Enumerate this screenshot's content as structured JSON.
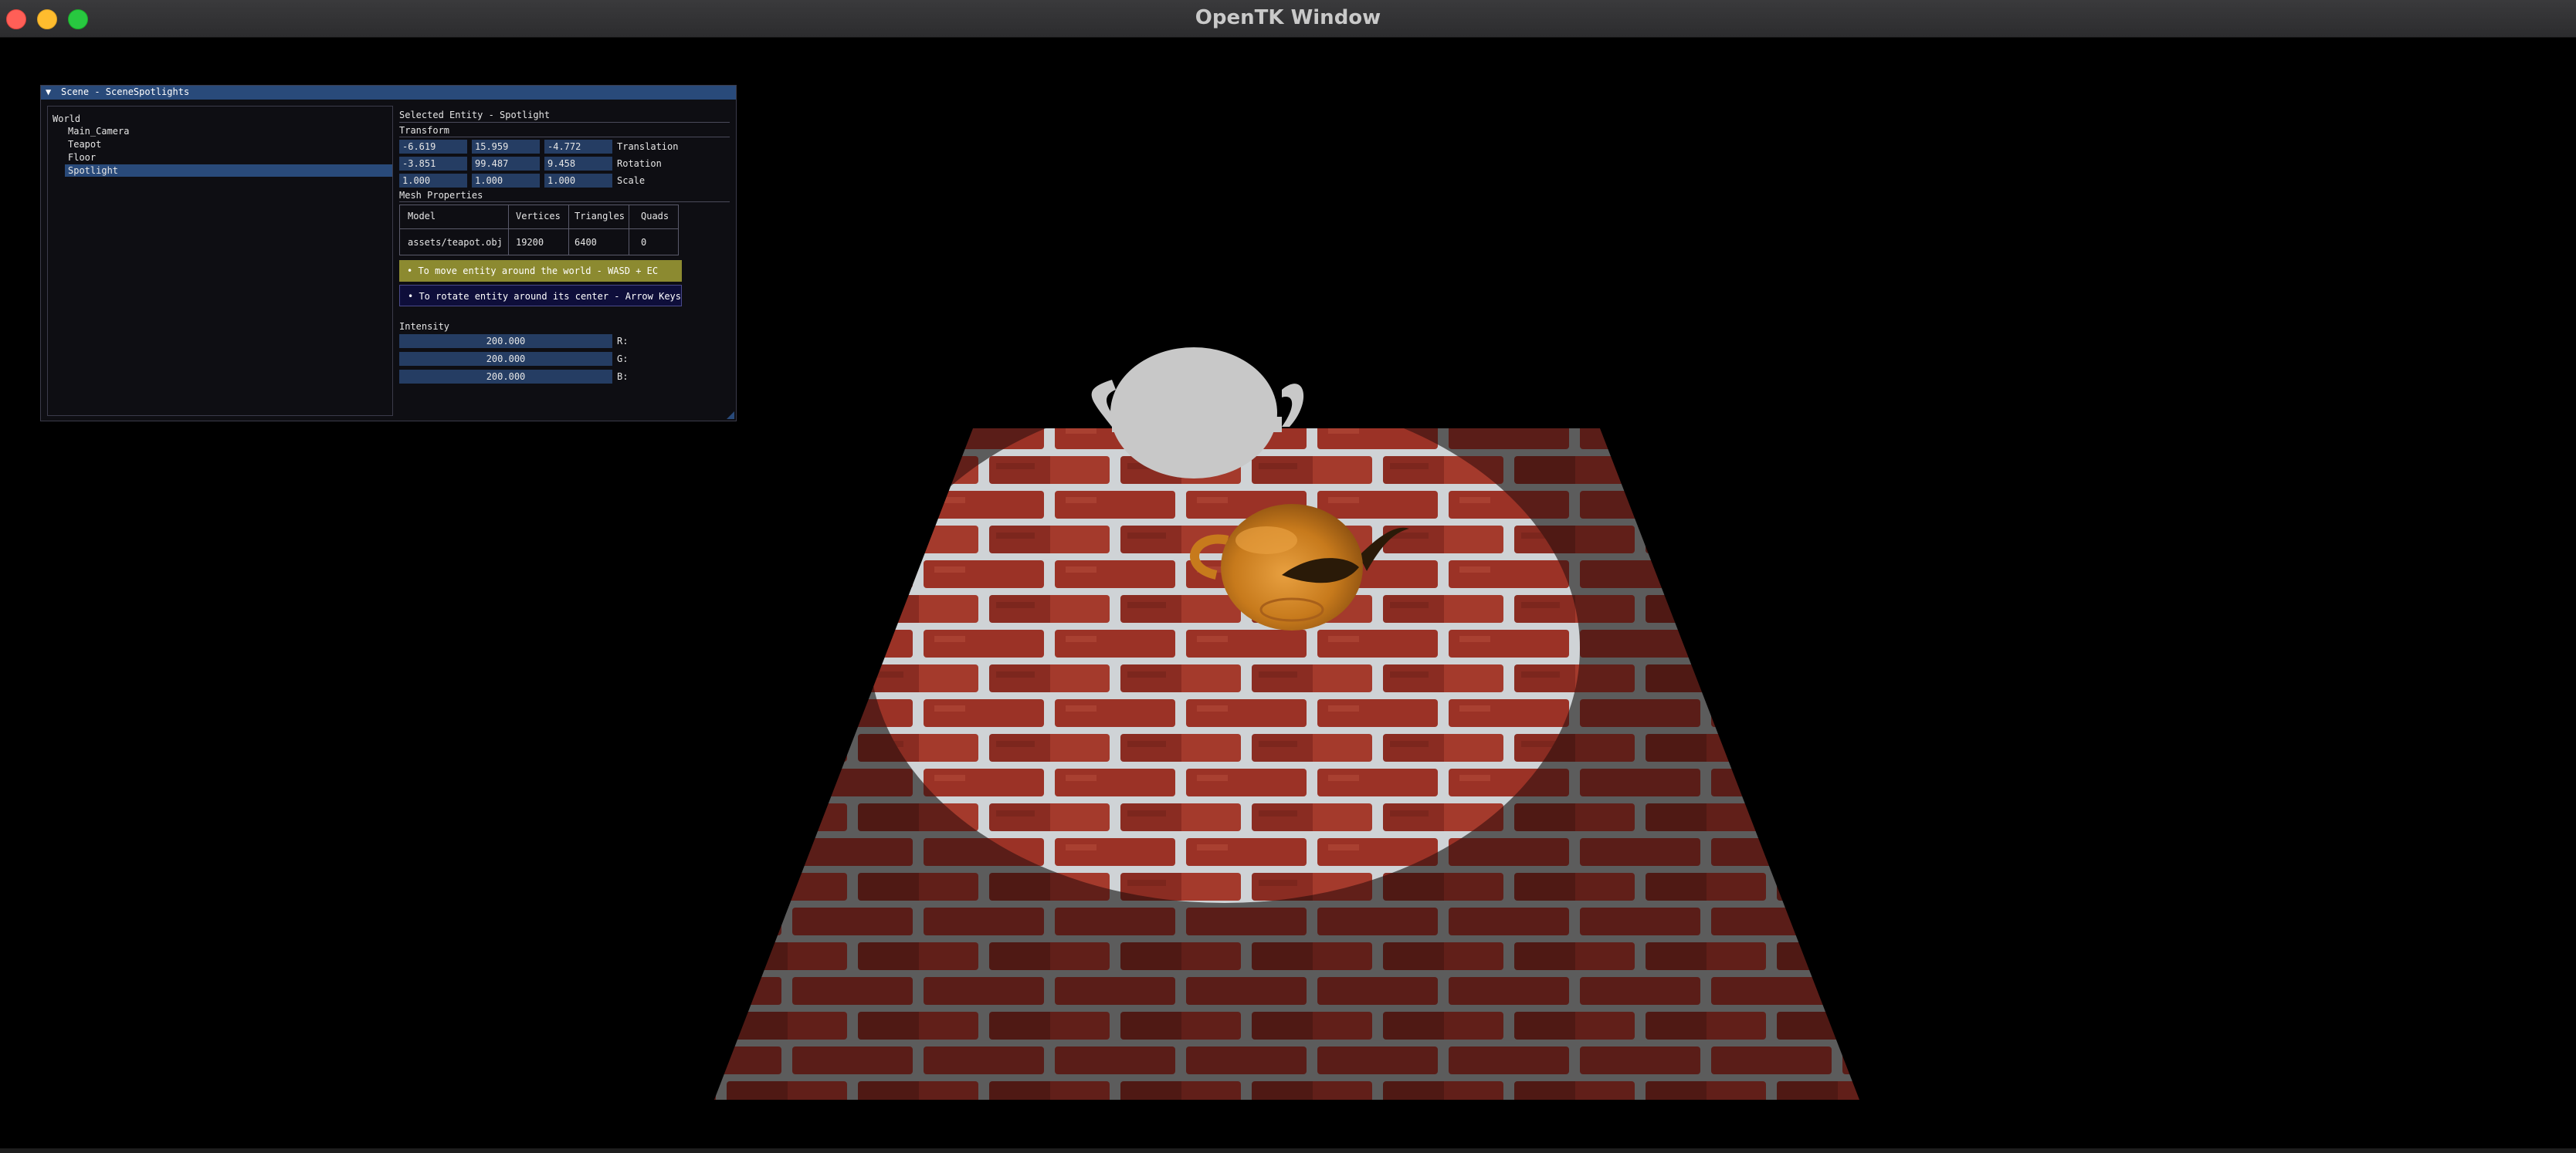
{
  "window": {
    "title": "OpenTK Window"
  },
  "panel": {
    "title": "Scene - SceneSpotlights",
    "tree": {
      "root": "World",
      "items": [
        {
          "label": "Main_Camera",
          "selected": false
        },
        {
          "label": "Teapot",
          "selected": false
        },
        {
          "label": "Floor",
          "selected": false
        },
        {
          "label": "Spotlight",
          "selected": true
        }
      ]
    },
    "selected_entity": "Selected Entity - Spotlight",
    "transform": {
      "header": "Transform",
      "rows": [
        {
          "values": [
            "-6.619",
            "15.959",
            "-4.772"
          ],
          "label": "Translation"
        },
        {
          "values": [
            "-3.851",
            "99.487",
            "9.458"
          ],
          "label": "Rotation"
        },
        {
          "values": [
            "1.000",
            "1.000",
            "1.000"
          ],
          "label": "Scale"
        }
      ]
    },
    "mesh": {
      "header": "Mesh Properties",
      "columns": [
        "Model",
        "Vertices",
        "Triangles",
        "Quads"
      ],
      "row": [
        "assets/teapot.obj",
        "19200",
        "6400",
        "0"
      ]
    },
    "hints": {
      "move": "• To move entity around the world - WASD + EC",
      "rotate": "• To rotate entity around its center - Arrow Keys"
    },
    "intensity": {
      "header": "Intensity",
      "channels": [
        {
          "value": "200.000",
          "label": "R:"
        },
        {
          "value": "200.000",
          "label": "G:"
        },
        {
          "value": "200.000",
          "label": "B:"
        }
      ]
    }
  },
  "colors": {
    "panel_accent": "#294a7a",
    "field_bg": "#253d63",
    "hint_move_bg": "#8c8a30",
    "hint_rotate_bg": "#0e0e3a",
    "brick": "#8e2f25",
    "mortar": "#b8bcbf",
    "teapot_wood": "#c77a1c",
    "light_teapot": "#c8c8c8"
  }
}
